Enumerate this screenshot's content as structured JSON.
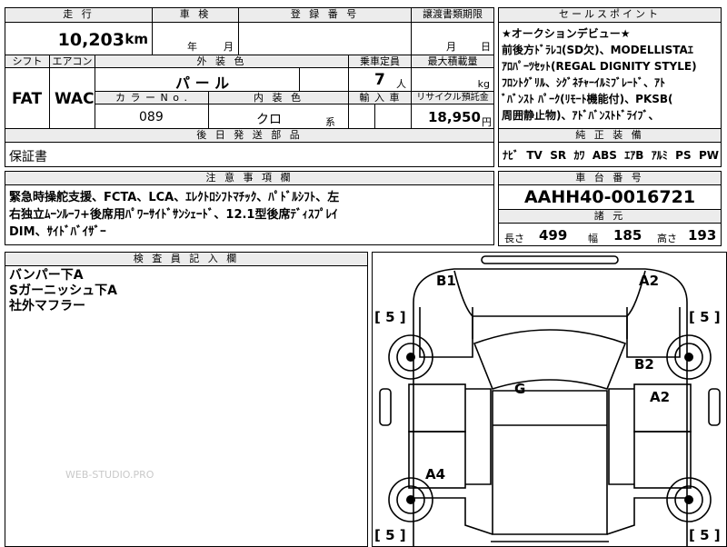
{
  "header": {
    "mileage_label": "走 行",
    "shaken_label": "車 検",
    "reg_label": "登 録 番 号",
    "transfer_label": "譲渡書類期限",
    "sales_label": "セールスポイント"
  },
  "row1": {
    "mileage_value": "10,203",
    "mileage_unit": "km",
    "year_unit": "年",
    "month_unit": "月",
    "reg_value": "",
    "transfer_month": "月",
    "transfer_day": "日"
  },
  "row2_headers": {
    "shift": "シフト",
    "aircon": "エアコン",
    "exterior": "外 装 色",
    "capacity": "乗車定員",
    "max_load": "最大積載量"
  },
  "row2": {
    "shift": "FAT",
    "aircon": "WAC",
    "exterior_value": "パ ー ル",
    "capacity_value": "7",
    "capacity_unit": "人",
    "load_unit": "kg"
  },
  "row3_headers": {
    "color_no": "カ ラ ー N o .",
    "interior": "内 装 色",
    "import": "輸 入 車",
    "recycle": "リサイクル預託金"
  },
  "row3": {
    "color_no": "089",
    "interior": "クロ",
    "interior_suffix": "系",
    "recycle_value": "18,950",
    "recycle_unit": "円"
  },
  "later_parts": {
    "label": "後 日 発 送 部 品",
    "value": "保証書"
  },
  "sales_point": {
    "lines": [
      "★オークションデビュー★",
      "前後方ﾄﾞﾗﾚｺ(SD欠)、MODELLISTAｴ",
      "ｱﾛﾊﾟｰﾂｾｯﾄ(REGAL DIGNITY STYLE)",
      "ﾌﾛﾝﾄｸﾞﾘﾙ、ｼｸﾞﾈﾁｬｰｲﾙﾐﾌﾞﾚｰﾄﾞ、ｱﾄ",
      "ﾞﾊﾞﾝｽﾄ ﾊﾟｰｸ(ﾘﾓｰﾄ機能付)、PKSB(",
      "周囲静止物)、ｱﾄﾞﾊﾞﾝｽﾄﾄﾞﾗｲﾌﾞ、"
    ]
  },
  "equipment": {
    "label": "純 正 装 備",
    "items": [
      "ﾅﾋﾞ",
      "TV",
      "SR",
      "ｶﾜ",
      "ABS",
      "ｴｱB",
      "ｱﾙﾐ",
      "PS",
      "PW"
    ]
  },
  "notes": {
    "label": "注 意 事 項 欄",
    "lines": [
      "緊急時操舵支援、FCTA、LCA、ｴﾚｸﾄﾛｼﾌﾄﾏﾁｯｸ、ﾊﾟﾄﾞﾙｼﾌﾄ、左",
      "右独立ﾑｰﾝﾙｰﾌ+後席用ﾊﾟﾜｰｻｲﾄﾞｻﾝｼｪｰﾄﾞ、12.1型後席ﾃﾞｨｽﾌﾟﾚｲ",
      "DIM、ｻｲﾄﾞﾊﾞｲｻﾞｰ"
    ]
  },
  "chassis": {
    "label": "車 台 番 号",
    "value": "AAHH40-0016721",
    "dims_label": "諸 元",
    "length_label": "長さ",
    "length_value": "499",
    "width_label": "幅",
    "width_value": "185",
    "height_label": "高さ",
    "height_value": "193"
  },
  "inspector": {
    "label": "検 査 員 記 入 欄",
    "lines": [
      "バンパー下A",
      "Sガーニッシュ下A",
      "社外マフラー"
    ]
  },
  "watermark": "WEB-STUDIO.PRO",
  "diagram": {
    "marks": {
      "b1": "B1",
      "a2_top": "A2",
      "b2": "B2",
      "a2_right": "A2",
      "g": "G",
      "a4": "A4"
    },
    "tires": {
      "fl": "[ 5 ]",
      "fr": "[ 5 ]",
      "rl": "[ 5 ]",
      "rr": "[ 5 ]"
    }
  }
}
